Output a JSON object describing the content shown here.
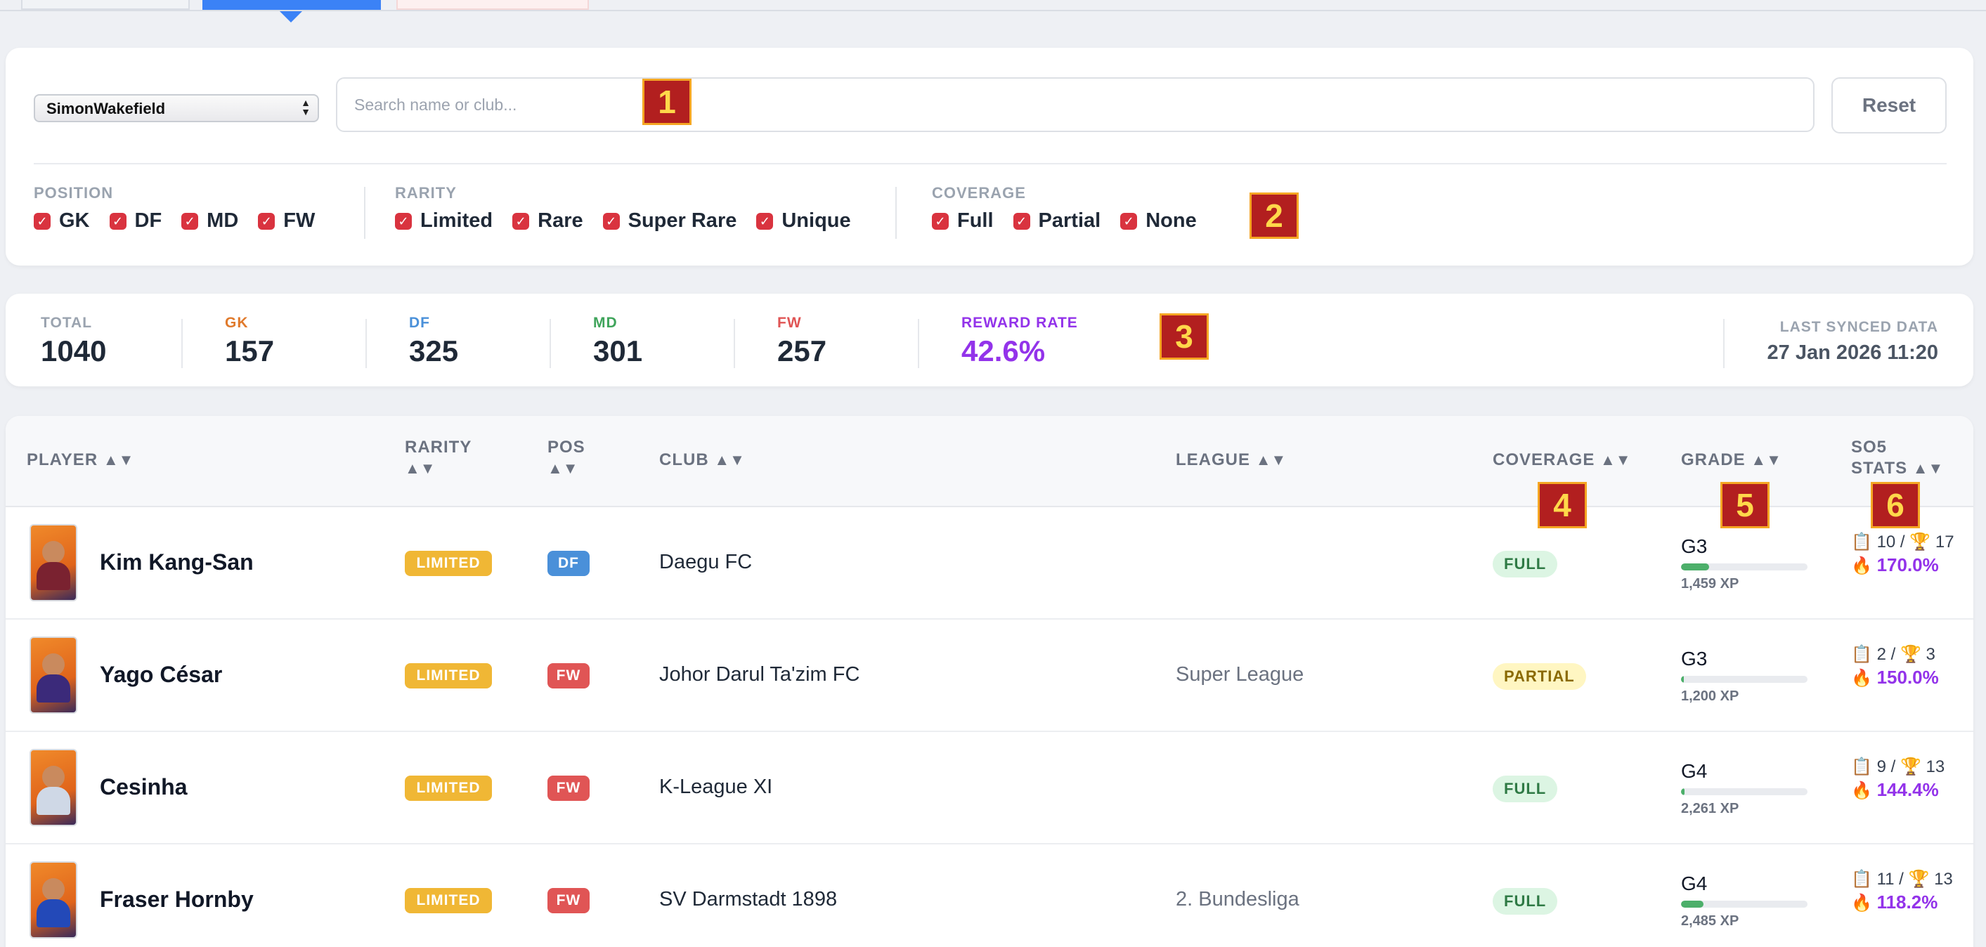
{
  "owner_select": {
    "value": "SimonWakefield"
  },
  "search": {
    "placeholder": "Search name or club..."
  },
  "reset_label": "Reset",
  "filters": {
    "position": {
      "label": "POSITION",
      "options": [
        "GK",
        "DF",
        "MD",
        "FW"
      ]
    },
    "rarity": {
      "label": "RARITY",
      "options": [
        "Limited",
        "Rare",
        "Super Rare",
        "Unique"
      ]
    },
    "coverage": {
      "label": "COVERAGE",
      "options": [
        "Full",
        "Partial",
        "None"
      ]
    }
  },
  "stats": {
    "total": {
      "label": "TOTAL",
      "value": "1040"
    },
    "gk": {
      "label": "GK",
      "value": "157"
    },
    "df": {
      "label": "DF",
      "value": "325"
    },
    "md": {
      "label": "MD",
      "value": "301"
    },
    "fw": {
      "label": "FW",
      "value": "257"
    },
    "reward": {
      "label": "REWARD RATE",
      "value": "42.6%"
    },
    "synced": {
      "label": "LAST SYNCED DATA",
      "value": "27 Jan 2026 11:20"
    }
  },
  "badges": [
    "1",
    "2",
    "3",
    "4",
    "5",
    "6"
  ],
  "table": {
    "headers": {
      "player": "PLAYER",
      "rarity": "RARITY",
      "pos": "POS",
      "club": "CLUB",
      "league": "LEAGUE",
      "coverage": "COVERAGE",
      "grade": "GRADE",
      "so5_line1": "SO5",
      "so5_line2": "STATS"
    },
    "sort_icon": "▲▼",
    "rows": [
      {
        "name": "Kim Kang-San",
        "rarity": "LIMITED",
        "pos": "DF",
        "club": "Daegu FC",
        "league": "",
        "coverage": "FULL",
        "grade": "G3",
        "xp": "1,459 XP",
        "xp_progress": 0.22,
        "so5_a": "10",
        "so5_b": "17",
        "rate": "170.0%"
      },
      {
        "name": "Yago César",
        "rarity": "LIMITED",
        "pos": "FW",
        "club": "Johor Darul Ta'zim FC",
        "league": "Super League",
        "coverage": "PARTIAL",
        "grade": "G3",
        "xp": "1,200 XP",
        "xp_progress": 0.0,
        "so5_a": "2",
        "so5_b": "3",
        "rate": "150.0%"
      },
      {
        "name": "Cesinha",
        "rarity": "LIMITED",
        "pos": "FW",
        "club": "K-League XI",
        "league": "",
        "coverage": "FULL",
        "grade": "G4",
        "xp": "2,261 XP",
        "xp_progress": 0.03,
        "so5_a": "9",
        "so5_b": "13",
        "rate": "144.4%"
      },
      {
        "name": "Fraser Hornby",
        "rarity": "LIMITED",
        "pos": "FW",
        "club": "SV Darmstadt 1898",
        "league": "2. Bundesliga",
        "coverage": "FULL",
        "grade": "G4",
        "xp": "2,485 XP",
        "xp_progress": 0.18,
        "so5_a": "11",
        "so5_b": "13",
        "rate": "118.2%"
      }
    ]
  },
  "colors": {
    "accent": "#3b82f6",
    "checkbox": "#d9333f",
    "gk": "#e07a2c",
    "df": "#4a90d9",
    "md": "#3fa45b",
    "fw": "#e05555",
    "reward": "#9333ea",
    "limited": "#f0b735",
    "full_bg": "#dcf5e3",
    "full_fg": "#2f7a45",
    "partial_bg": "#fff6c2",
    "partial_fg": "#8a6a00",
    "xp_fill": "#4caf6a"
  },
  "icons": {
    "checkbox": "checkbox-checked-icon",
    "lineups": "clipboard-icon",
    "wins": "trophy-icon",
    "streak": "fire-icon"
  }
}
